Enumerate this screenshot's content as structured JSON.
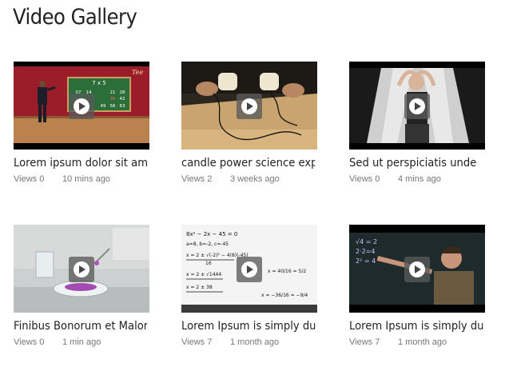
{
  "page": {
    "title": "Video Gallery"
  },
  "videos": [
    {
      "title": "Lorem ipsum dolor sit ame",
      "views": "Views 0",
      "time": "10 mins ago",
      "board": {
        "heading": "7 x 5",
        "cells": [
          "07",
          "14",
          "21",
          "28",
          "35",
          "42",
          "49",
          "56",
          "63"
        ]
      }
    },
    {
      "title": "candle power science expe",
      "views": "Views 2",
      "time": "3 weeks ago"
    },
    {
      "title": "Sed ut perspiciatis unde",
      "views": "Views 0",
      "time": "4 mins ago"
    },
    {
      "title": "Finibus Bonorum et Maloru",
      "views": "Views 0",
      "time": "1 min ago"
    },
    {
      "title": "Lorem Ipsum is simply dum",
      "views": "Views 7",
      "time": "1 month ago",
      "board": {
        "line1": "8x² − 2x − 45 = 0",
        "line2": "a=8, b=-2, c=-45",
        "line3": "x = 2 ± √(-2)² − 4(8)(-45)",
        "line4": "16",
        "line5": "x = 2 ± √1444",
        "line6": "x = 2 ± 38",
        "line7": "x = 40/16 = 5/2",
        "line8": "x = −36/16 = −9/4"
      }
    },
    {
      "title": "Lorem Ipsum is simply dum",
      "views": "Views 7",
      "time": "1 month ago",
      "board": {
        "line1": "√4 = 2",
        "line2": "2·2=4",
        "line3": "2² = 4"
      }
    }
  ]
}
